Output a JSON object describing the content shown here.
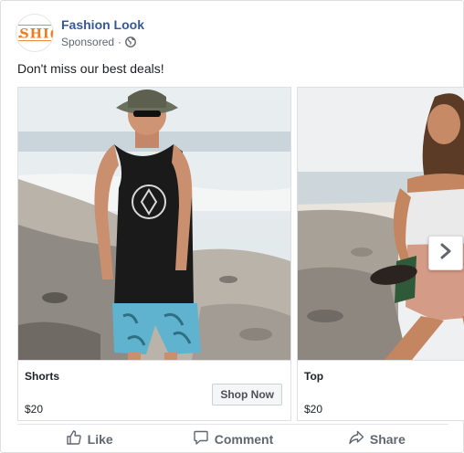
{
  "post": {
    "page_name": "Fashion Look",
    "avatar_text": "SHI",
    "sponsored_label": "Sponsored",
    "separator": "·",
    "text": "Don't miss our best deals!"
  },
  "carousel": {
    "cards": [
      {
        "title": "Shorts",
        "price": "$20",
        "cta_label": "Shop Now"
      },
      {
        "title": "Top",
        "price": "$20"
      }
    ]
  },
  "actions": {
    "like_label": "Like",
    "comment_label": "Comment",
    "share_label": "Share"
  },
  "colors": {
    "page_name": "#385898",
    "brand_orange": "#f07a1f",
    "secondary_text": "#606770",
    "border": "#dddfe2"
  },
  "icons": [
    "globe-icon",
    "chevron-right-icon",
    "like-icon",
    "comment-icon",
    "share-icon"
  ]
}
